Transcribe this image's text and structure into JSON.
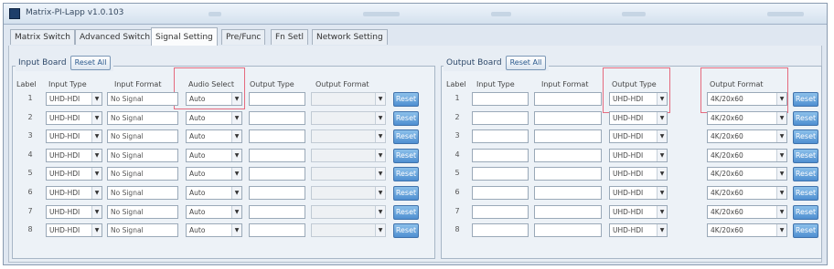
{
  "window": {
    "title": "Matrix-PI-Lapp v1.0.103"
  },
  "tabs": [
    {
      "label": "Matrix Switch",
      "active": false
    },
    {
      "label": "Advanced Switch",
      "active": false
    },
    {
      "label": "Signal Setting",
      "active": true
    },
    {
      "label": "Pre/Func",
      "active": false
    },
    {
      "label": "Fn Setl",
      "active": false
    },
    {
      "label": "Network Setting",
      "active": false
    }
  ],
  "input_board": {
    "legend": "Input Board",
    "reset_all_label": "Reset All",
    "headers": {
      "label": "Label",
      "input_type": "Input Type",
      "input_format": "Input Format",
      "audio_select": "Audio Select",
      "output_type": "Output Type",
      "output_format": "Output Format"
    },
    "rows": [
      {
        "label": "1",
        "input_type": "UHD-HDI",
        "input_format": "No Signal",
        "audio_select": "Auto",
        "reset": "Reset"
      },
      {
        "label": "2",
        "input_type": "UHD-HDI",
        "input_format": "No Signal",
        "audio_select": "Auto",
        "reset": "Reset"
      },
      {
        "label": "3",
        "input_type": "UHD-HDI",
        "input_format": "No Signal",
        "audio_select": "Auto",
        "reset": "Reset"
      },
      {
        "label": "4",
        "input_type": "UHD-HDI",
        "input_format": "No Signal",
        "audio_select": "Auto",
        "reset": "Reset"
      },
      {
        "label": "5",
        "input_type": "UHD-HDI",
        "input_format": "No Signal",
        "audio_select": "Auto",
        "reset": "Reset"
      },
      {
        "label": "6",
        "input_type": "UHD-HDI",
        "input_format": "No Signal",
        "audio_select": "Auto",
        "reset": "Reset"
      },
      {
        "label": "7",
        "input_type": "UHD-HDI",
        "input_format": "No Signal",
        "audio_select": "Auto",
        "reset": "Reset"
      },
      {
        "label": "8",
        "input_type": "UHD-HDI",
        "input_format": "No Signal",
        "audio_select": "Auto",
        "reset": "Reset"
      }
    ]
  },
  "output_board": {
    "legend": "Output Board",
    "reset_all_label": "Reset All",
    "headers": {
      "label": "Label",
      "input_type": "Input Type",
      "input_format": "Input Format",
      "output_type": "Output Type",
      "output_format": "Output Format"
    },
    "rows": [
      {
        "label": "1",
        "output_type": "UHD-HDI",
        "output_format": "4K/20x60",
        "reset": "Reset"
      },
      {
        "label": "2",
        "output_type": "UHD-HDI",
        "output_format": "4K/20x60",
        "reset": "Reset"
      },
      {
        "label": "3",
        "output_type": "UHD-HDI",
        "output_format": "4K/20x60",
        "reset": "Reset"
      },
      {
        "label": "4",
        "output_type": "UHD-HDI",
        "output_format": "4K/20x60",
        "reset": "Reset"
      },
      {
        "label": "5",
        "output_type": "UHD-HDI",
        "output_format": "4K/20x60",
        "reset": "Reset"
      },
      {
        "label": "6",
        "output_type": "UHD-HDI",
        "output_format": "4K/20x60",
        "reset": "Reset"
      },
      {
        "label": "7",
        "output_type": "UHD-HDI",
        "output_format": "4K/20x60",
        "reset": "Reset"
      },
      {
        "label": "8",
        "output_type": "UHD-HDI",
        "output_format": "4K/20x60",
        "reset": "Reset"
      }
    ]
  },
  "colors": {
    "highlight": "#e56a7e",
    "reset_button": "#4f8fd1",
    "panel": "#e7edf4"
  }
}
